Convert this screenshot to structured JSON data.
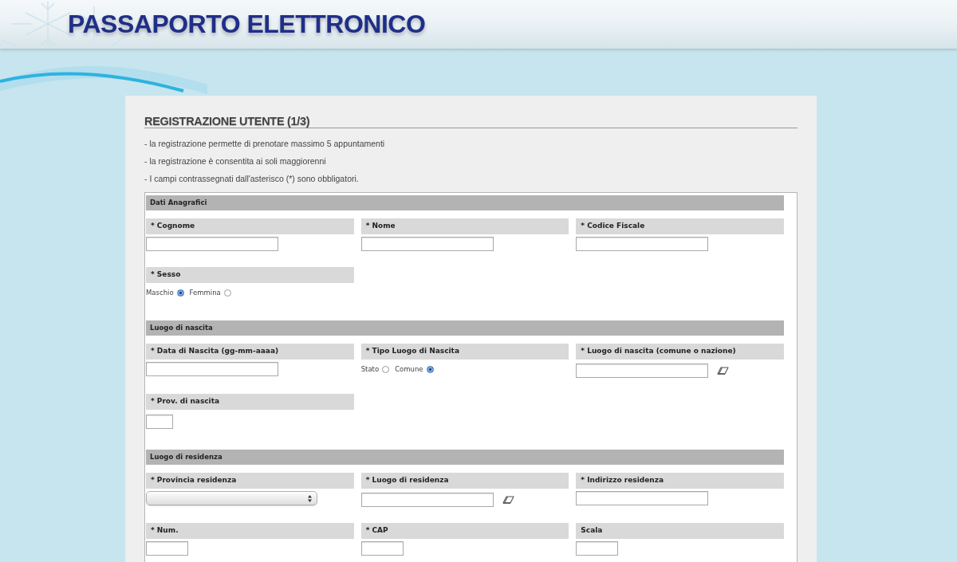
{
  "header": {
    "title": "PASSAPORTO ELETTRONICO"
  },
  "panel": {
    "title": "REGISTRAZIONE UTENTE (1/3)",
    "notes": [
      "- la registrazione permette di prenotare massimo 5 appuntamenti",
      "- la registrazione è consentita ai soli maggiorenni",
      "- I campi contrassegnati dall'asterisco (*) sono obbligatori."
    ]
  },
  "form": {
    "sections": [
      {
        "title": "Dati Anagrafici",
        "rows": [
          {
            "fields": [
              {
                "label": "* Cognome",
                "kind": "text"
              },
              {
                "label": "* Nome",
                "kind": "text"
              },
              {
                "label": "* Codice Fiscale",
                "kind": "text"
              }
            ]
          },
          {
            "fields": [
              {
                "label": "* Sesso",
                "kind": "radio",
                "options": [
                  {
                    "label": "Maschio",
                    "selected": true
                  },
                  {
                    "label": "Femmina",
                    "selected": false
                  }
                ]
              }
            ]
          }
        ]
      },
      {
        "title": "Luogo di nascita",
        "rows": [
          {
            "fields": [
              {
                "label": "* Data di Nascita (gg-mm-aaaa)",
                "kind": "text"
              },
              {
                "label": "* Tipo Luogo di Nascita",
                "kind": "radio",
                "options": [
                  {
                    "label": "Stato",
                    "selected": false
                  },
                  {
                    "label": "Comune",
                    "selected": true
                  }
                ]
              },
              {
                "label": "* Luogo di nascita (comune o nazione)",
                "kind": "lookup"
              }
            ]
          },
          {
            "fields": [
              {
                "label": "* Prov. di nascita",
                "kind": "tiny_text"
              }
            ]
          }
        ]
      },
      {
        "title": "Luogo di residenza",
        "rows": [
          {
            "fields": [
              {
                "label": "* Provincia residenza",
                "kind": "select"
              },
              {
                "label": "* Luogo di residenza",
                "kind": "lookup"
              },
              {
                "label": "* Indirizzo residenza",
                "kind": "text"
              }
            ]
          },
          {
            "fields": [
              {
                "label": "* Num.",
                "kind": "short_text"
              },
              {
                "label": "* CAP",
                "kind": "short_text"
              },
              {
                "label": "Scala",
                "kind": "short_text"
              }
            ]
          }
        ]
      }
    ]
  }
}
